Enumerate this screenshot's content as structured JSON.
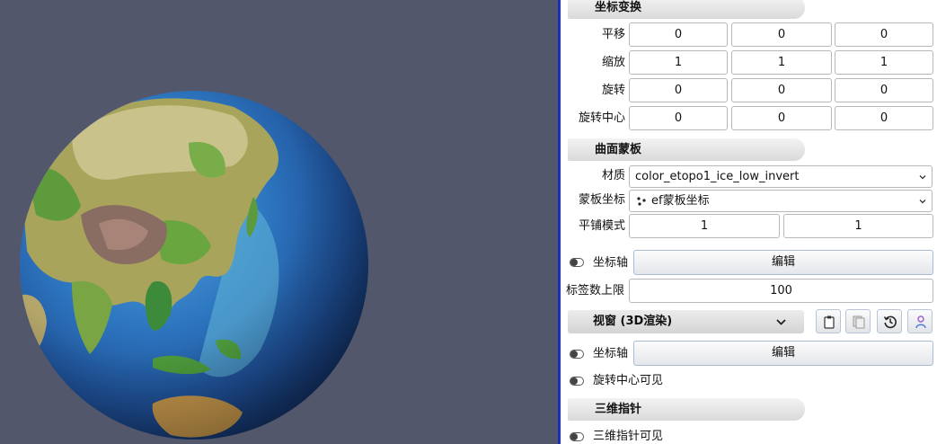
{
  "viewport": {
    "background": "#52576b",
    "object": "earth-globe"
  },
  "panel": {
    "transform": {
      "header": "坐标变换",
      "rows": [
        {
          "label": "平移",
          "values": [
            "0",
            "0",
            "0"
          ]
        },
        {
          "label": "缩放",
          "values": [
            "1",
            "1",
            "1"
          ]
        },
        {
          "label": "旋转",
          "values": [
            "0",
            "0",
            "0"
          ]
        },
        {
          "label": "旋转中心",
          "values": [
            "0",
            "0",
            "0"
          ]
        }
      ]
    },
    "surface_mask": {
      "header": "曲面蒙板",
      "material_label": "材质",
      "material_value": "color_etopo1_ice_low_invert",
      "mask_coord_label": "蒙板坐标",
      "mask_coord_value": "ef蒙板坐标",
      "tile_label": "平铺模式",
      "tile_values": [
        "1",
        "1"
      ]
    },
    "axis_row": {
      "label": "坐标轴",
      "button": "编辑"
    },
    "label_limit": {
      "label": "标签数上限",
      "value": "100"
    },
    "view": {
      "header": "视窗 (3D渲染)",
      "icons": [
        "copy-icon",
        "paste-icon",
        "history-icon",
        "person-icon"
      ],
      "axis_label": "坐标轴",
      "axis_button": "编辑",
      "rotation_center_visible_label": "旋转中心可见"
    },
    "compass": {
      "header": "三维指针",
      "visible_label": "三维指针可见"
    }
  },
  "colors": {
    "divider": "#1c2fb8",
    "viewport": "#52576b",
    "button_border": "#a9bcd6"
  }
}
